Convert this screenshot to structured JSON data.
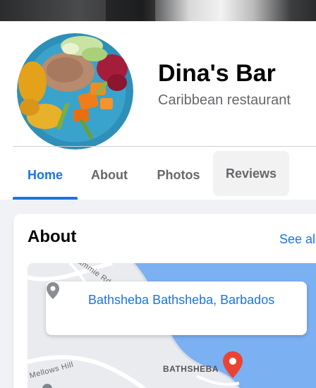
{
  "page": {
    "name": "Dina's Bar",
    "category": "Caribbean restaurant"
  },
  "tabs": [
    {
      "label": "Home",
      "active": true
    },
    {
      "label": "About",
      "active": false
    },
    {
      "label": "Photos",
      "active": false
    },
    {
      "label": "Reviews",
      "active": false
    }
  ],
  "about": {
    "title": "About",
    "see_all": "See all",
    "address": "Bathsheba Bathsheba, Barbados",
    "map_labels": {
      "town": "BATHSHEBA",
      "hill": "Mellows Hill",
      "road": "Cammie Rd"
    }
  },
  "icons": {
    "location": "map-pin-icon",
    "marker": "red-map-marker-icon"
  },
  "colors": {
    "accent": "#1b74e4",
    "water": "#7bb0f2",
    "marker": "#ea4335"
  }
}
